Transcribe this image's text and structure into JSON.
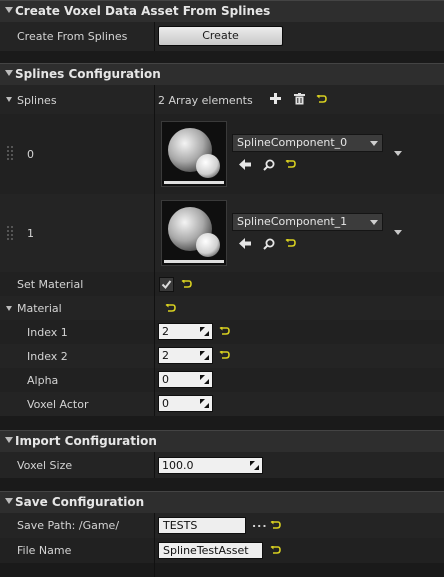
{
  "sections": {
    "create": "Create Voxel Data Asset From Splines",
    "splines_config": "Splines Configuration",
    "import_config": "Import Configuration",
    "save_config": "Save Configuration"
  },
  "create_row": {
    "label": "Create From Splines",
    "button": "Create"
  },
  "splines": {
    "label": "Splines",
    "count_text": "2 Array elements",
    "elements": [
      {
        "index": "0",
        "component": "SplineComponent_0"
      },
      {
        "index": "1",
        "component": "SplineComponent_1"
      }
    ]
  },
  "set_material": {
    "label": "Set Material",
    "checked": true
  },
  "material": {
    "label": "Material",
    "fields": [
      {
        "label": "Index 1",
        "value": "2"
      },
      {
        "label": "Index 2",
        "value": "2"
      },
      {
        "label": "Alpha",
        "value": "0"
      },
      {
        "label": "Voxel Actor",
        "value": "0"
      }
    ]
  },
  "import": {
    "voxel_size_label": "Voxel Size",
    "voxel_size_value": "100.0"
  },
  "save": {
    "path_label": "Save Path: /Game/",
    "path_value": "TESTS",
    "browse": "...",
    "file_label": "File Name",
    "file_value": "SplineTestAsset"
  },
  "icons": [
    "add-icon",
    "trash-icon",
    "reset-arrow-icon",
    "use-selected-arrow-icon",
    "browse-magnifier-icon",
    "checkbox-check-icon",
    "numeric-drag-grip-icon"
  ],
  "colors": {
    "panel": "#1a1a1a",
    "category": "#2e2e2e",
    "reset_arrow": "#d8d020"
  }
}
